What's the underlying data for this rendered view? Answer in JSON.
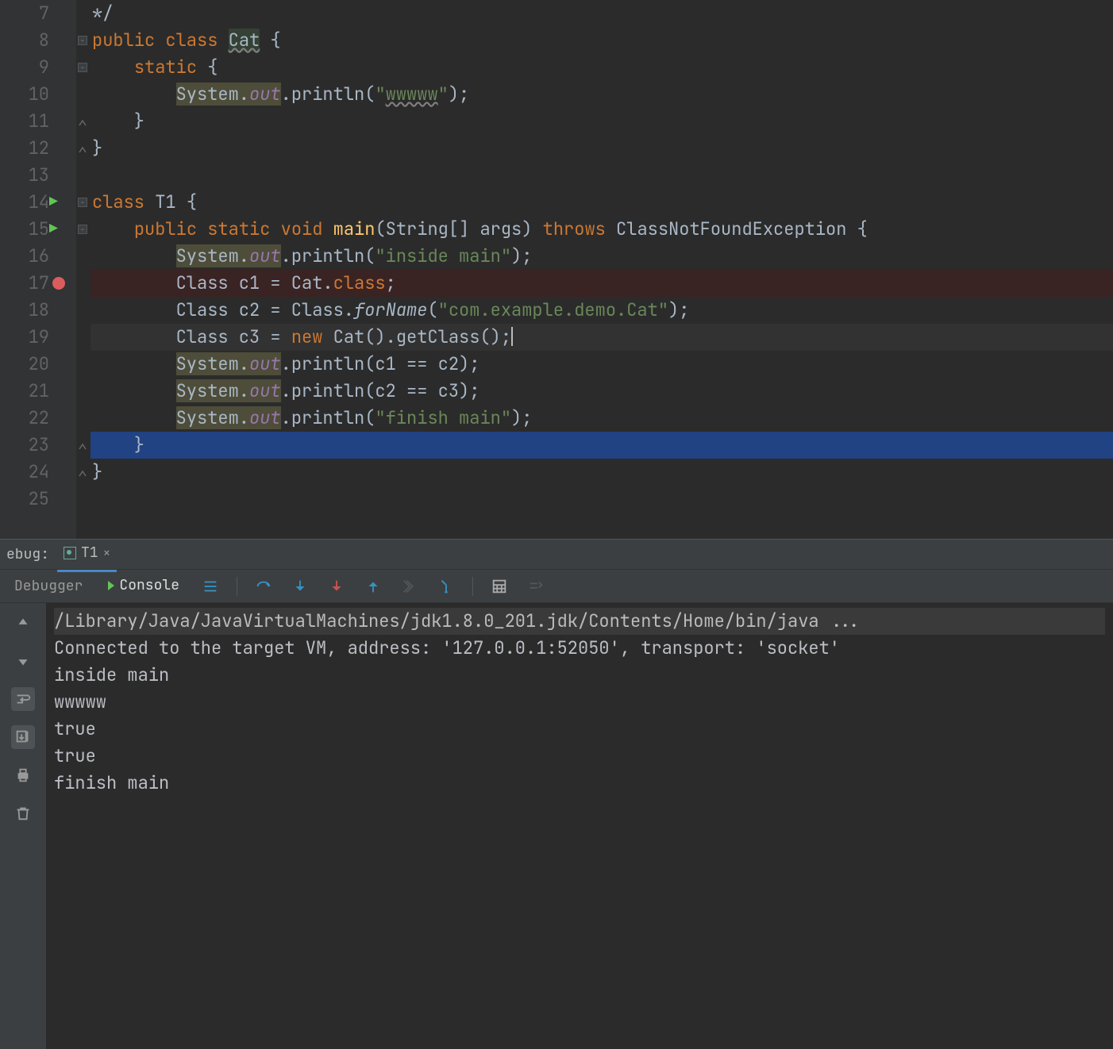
{
  "editor": {
    "lines": [
      {
        "n": 7,
        "html": "*/",
        "fold": ""
      },
      {
        "n": 8,
        "html": "<span class='kw'>public</span> <span class='kw'>class</span> <span class='hl-cat'>Cat</span> {",
        "fold": "-"
      },
      {
        "n": 9,
        "html": "    <span class='kw'>static</span> {",
        "fold": "-"
      },
      {
        "n": 10,
        "html": "        <span class='hl-out'>System.<span class='field'>out</span></span>.println(<span class='str'>\"<span class='hl-str-u'>wwwww</span>\"</span>);"
      },
      {
        "n": 11,
        "html": "    }",
        "fold": "^"
      },
      {
        "n": 12,
        "html": "}",
        "fold": "^"
      },
      {
        "n": 13,
        "html": ""
      },
      {
        "n": 14,
        "html": "<span class='kw'>class</span> T1 {",
        "run": true,
        "fold": "-"
      },
      {
        "n": 15,
        "html": "    <span class='kw'>public</span> <span class='kw'>static</span> <span class='kw'>void</span> <span class='fn'>main</span>(String[] args) <span class='kw'>throws</span> ClassNotFoundException {",
        "run": true,
        "fold": "-"
      },
      {
        "n": 16,
        "html": "        <span class='hl-out'>System.<span class='field'>out</span></span>.println(<span class='str'>\"inside main\"</span>);"
      },
      {
        "n": 17,
        "html": "        Class c1 = Cat.<span class='kw'>class</span>;",
        "bp": true,
        "bpline": true
      },
      {
        "n": 18,
        "html": "        Class c2 = Class.<span class='staticm'>forName</span>(<span class='str'>\"com.example.demo.Cat\"</span>);"
      },
      {
        "n": 19,
        "html": "        Class c3 = <span class='kw'>new</span> Cat().getClass();",
        "cur": true,
        "caret": true
      },
      {
        "n": 20,
        "html": "        <span class='hl-out'>System.<span class='field'>out</span></span>.println(c1 == c2);"
      },
      {
        "n": 21,
        "html": "        <span class='hl-out'>System.<span class='field'>out</span></span>.println(c2 == c3);"
      },
      {
        "n": 22,
        "html": "        <span class='hl-out'>System.<span class='field'>out</span></span>.println(<span class='str'>\"finish main\"</span>);"
      },
      {
        "n": 23,
        "html": "    }",
        "sel": true,
        "fold": "^"
      },
      {
        "n": 24,
        "html": "}",
        "fold": "^"
      },
      {
        "n": 25,
        "html": ""
      }
    ]
  },
  "debug": {
    "label": "ebug:",
    "run_config": "T1",
    "tabs": {
      "debugger": "Debugger",
      "console": "Console"
    },
    "console_lines": [
      {
        "cls": "cmd",
        "text": "/Library/Java/JavaVirtualMachines/jdk1.8.0_201.jdk/Contents/Home/bin/java ..."
      },
      {
        "cls": "",
        "text": "Connected to the target VM, address: '127.0.0.1:52050', transport: 'socket'"
      },
      {
        "cls": "",
        "text": "inside main"
      },
      {
        "cls": "",
        "text": "wwwww"
      },
      {
        "cls": "",
        "text": "true"
      },
      {
        "cls": "",
        "text": "true"
      },
      {
        "cls": "",
        "text": "finish main"
      }
    ]
  }
}
